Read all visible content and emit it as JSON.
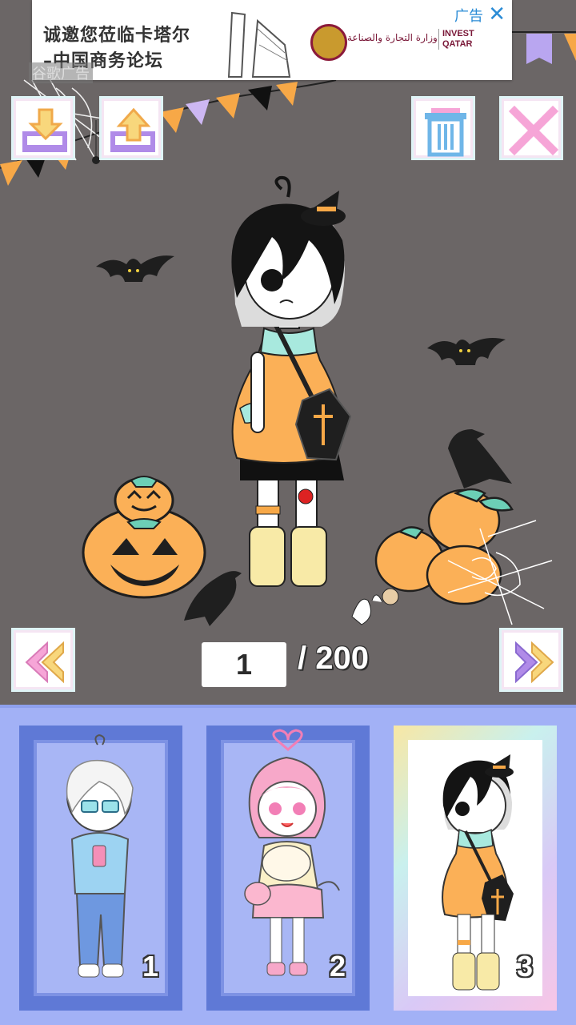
{
  "ad": {
    "line1": "诚邀您莅临卡塔尔",
    "line2": "–中国商务论坛",
    "label": "广告",
    "close": "✕",
    "google_label": "谷歌广告",
    "logo_caption": "وزارة التجارة والصناعة",
    "brand": "INVEST QATAR"
  },
  "toolbar": {
    "download": "download-icon",
    "upload": "upload-icon",
    "trash": "trash-icon",
    "close": "close-icon"
  },
  "pager": {
    "current": "1",
    "total": "/ 200",
    "prev_icon": "double-chevron-left-icon",
    "next_icon": "double-chevron-right-icon"
  },
  "slots": [
    {
      "number": "1",
      "character": "white-hair-boy-glasses"
    },
    {
      "number": "2",
      "character": "pink-hair-girl-cat"
    },
    {
      "number": "3",
      "character": "black-hair-halloween-girl",
      "selected": true
    }
  ],
  "colors": {
    "stage_bg": "#6b6666",
    "panel_bg": "#a2b1f6",
    "slot_frame": "#5f79d6",
    "pumpkin": "#fbb057",
    "accent_pink": "#f6a5d7"
  }
}
